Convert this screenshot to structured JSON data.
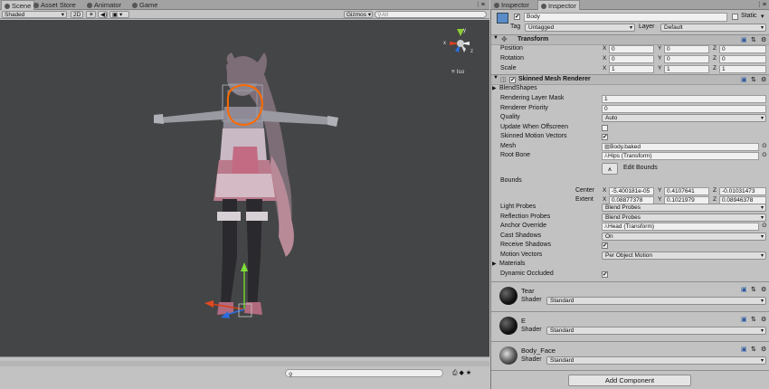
{
  "scene_tabs": [
    {
      "label": "Scene",
      "icon": "scene-icon"
    },
    {
      "label": "Asset Store",
      "icon": "store-icon"
    },
    {
      "label": "Animator",
      "icon": "animator-icon"
    },
    {
      "label": "Game",
      "icon": "game-icon"
    }
  ],
  "inspector_tabs": [
    {
      "label": "Inspector",
      "icon": "info-icon"
    },
    {
      "label": "Inspector",
      "icon": "info-icon"
    }
  ],
  "scene_toolbar": {
    "shading": "Shaded",
    "mode_2d": "2D",
    "gizmos": "Gizmos",
    "search_placeholder": "All"
  },
  "gizmo": {
    "persp_label": "Iso",
    "x": "x",
    "y": "y",
    "z": "z"
  },
  "object": {
    "name": "Body",
    "static_label": "Static",
    "tag_label": "Tag",
    "tag_value": "Untagged",
    "layer_label": "Layer",
    "layer_value": "Default"
  },
  "transform": {
    "title": "Transform",
    "axes": [
      "X",
      "Y",
      "Z"
    ],
    "rows": [
      {
        "label": "Position",
        "values": [
          "0",
          "0",
          "0"
        ]
      },
      {
        "label": "Rotation",
        "values": [
          "0",
          "0",
          "0"
        ]
      },
      {
        "label": "Scale",
        "values": [
          "1",
          "1",
          "1"
        ]
      }
    ]
  },
  "smr": {
    "title": "Skinned Mesh Renderer",
    "blendshapes": "BlendShapes",
    "rendering_layer_mask": {
      "label": "Rendering Layer Mask",
      "value": "1"
    },
    "renderer_priority": {
      "label": "Renderer Priority",
      "value": "0"
    },
    "quality": {
      "label": "Quality",
      "value": "Auto"
    },
    "update_offscreen": {
      "label": "Update When Offscreen",
      "checked": false
    },
    "skinned_motion": {
      "label": "Skinned Motion Vectors",
      "checked": true
    },
    "mesh": {
      "label": "Mesh",
      "value": "Body.baked"
    },
    "root_bone": {
      "label": "Root Bone",
      "value": "Hips (Transform)"
    },
    "edit_bounds": "Edit Bounds",
    "bounds_label": "Bounds",
    "center": {
      "label": "Center",
      "values": [
        "-5.400181e-05",
        "0.4107641",
        "-0.01031473"
      ]
    },
    "extent": {
      "label": "Extent",
      "values": [
        "0.08877378",
        "0.1021979",
        "0.08946378"
      ]
    },
    "light_probes": {
      "label": "Light Probes",
      "value": "Blend Probes"
    },
    "reflection_probes": {
      "label": "Reflection Probes",
      "value": "Blend Probes"
    },
    "anchor_override": {
      "label": "Anchor Override",
      "value": "Head (Transform)"
    },
    "cast_shadows": {
      "label": "Cast Shadows",
      "value": "On"
    },
    "receive_shadows": {
      "label": "Receive Shadows",
      "checked": true
    },
    "motion_vectors": {
      "label": "Motion Vectors",
      "value": "Per Object Motion"
    },
    "materials": "Materials",
    "dynamic_occluded": {
      "label": "Dynamic Occluded",
      "checked": true
    }
  },
  "materials": [
    {
      "name": "Tear",
      "shader_label": "Shader",
      "shader": "Standard"
    },
    {
      "name": "E",
      "shader_label": "Shader",
      "shader": "Standard"
    },
    {
      "name": "Body_Face",
      "shader_label": "Shader",
      "shader": "Standard"
    }
  ],
  "add_component": "Add Component",
  "colors": {
    "viewport": "#444546",
    "panel": "#c2c2c2",
    "selection_outline": "#ff6a00"
  }
}
